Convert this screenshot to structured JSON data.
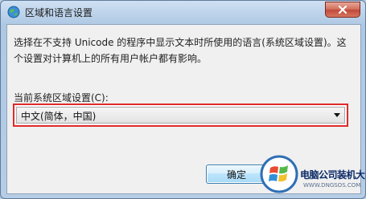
{
  "window": {
    "title": "区域和语言设置"
  },
  "dialog": {
    "description": "选择在不支持 Unicode 的程序中显示文本时所使用的语言(系统区域设置)。这个设置对计算机上的所有用户帐户都有影响。",
    "locale_label": "当前系统区域设置(C):",
    "locale_select": {
      "selected": "中文(简体，中国)"
    },
    "ok_label": "确定"
  },
  "watermark": {
    "title": "电脑公司装机大师",
    "url": "WWW.DNGSOS.COM"
  },
  "colors": {
    "highlight_border": "#e02a2a",
    "close_button": "#c0473a",
    "title_bar": "#aec8e4"
  },
  "icons": [
    "globe-icon",
    "close-icon",
    "dropdown-arrow-icon",
    "windows-logo-icon"
  ]
}
